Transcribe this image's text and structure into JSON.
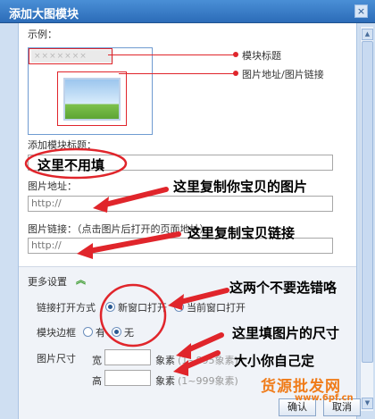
{
  "window": {
    "title": "添加大图模块",
    "close_label": "×"
  },
  "example": {
    "label": "示例：",
    "title_placeholder": "×××××××",
    "legend_title": "模块标题",
    "legend_image": "图片地址/图片链接"
  },
  "form": {
    "module_title_label": "添加模块标题：",
    "image_url_label": "图片地址：",
    "image_url_value": "http://",
    "image_link_label": "图片链接：（点击图片后打开的页面地址）",
    "image_link_value": "http://"
  },
  "more": {
    "header": "更多设置",
    "open_mode_label": "链接打开方式",
    "open_new": "新窗口打开",
    "open_current": "当前窗口打开",
    "border_label": "模块边框",
    "border_yes": "有",
    "border_no": "无",
    "size_label": "图片尺寸",
    "width_label": "宽",
    "height_label": "高",
    "width_hint_unit": "象素",
    "width_hint": "(1~895象素)",
    "height_hint_unit": "象素",
    "height_hint": "(1~999象素)"
  },
  "buttons": {
    "ok": "确认",
    "cancel": "取消"
  },
  "annotations": {
    "no_need": "这里不用填",
    "copy_image": "这里复制你宝贝的图片",
    "copy_link": "这里复制宝贝链接",
    "dont_choose_wrong": "这两个不要选错咯",
    "fill_size": "这里填图片的尺寸",
    "size_yourself": "大小你自己定"
  },
  "watermark": {
    "text": "货源批发网",
    "url": "www.6pf.cn"
  },
  "colors": {
    "annotation_red": "#e0252b",
    "titlebar_blue": "#2c6cb8",
    "watermark_orange": "#f07c1a"
  }
}
